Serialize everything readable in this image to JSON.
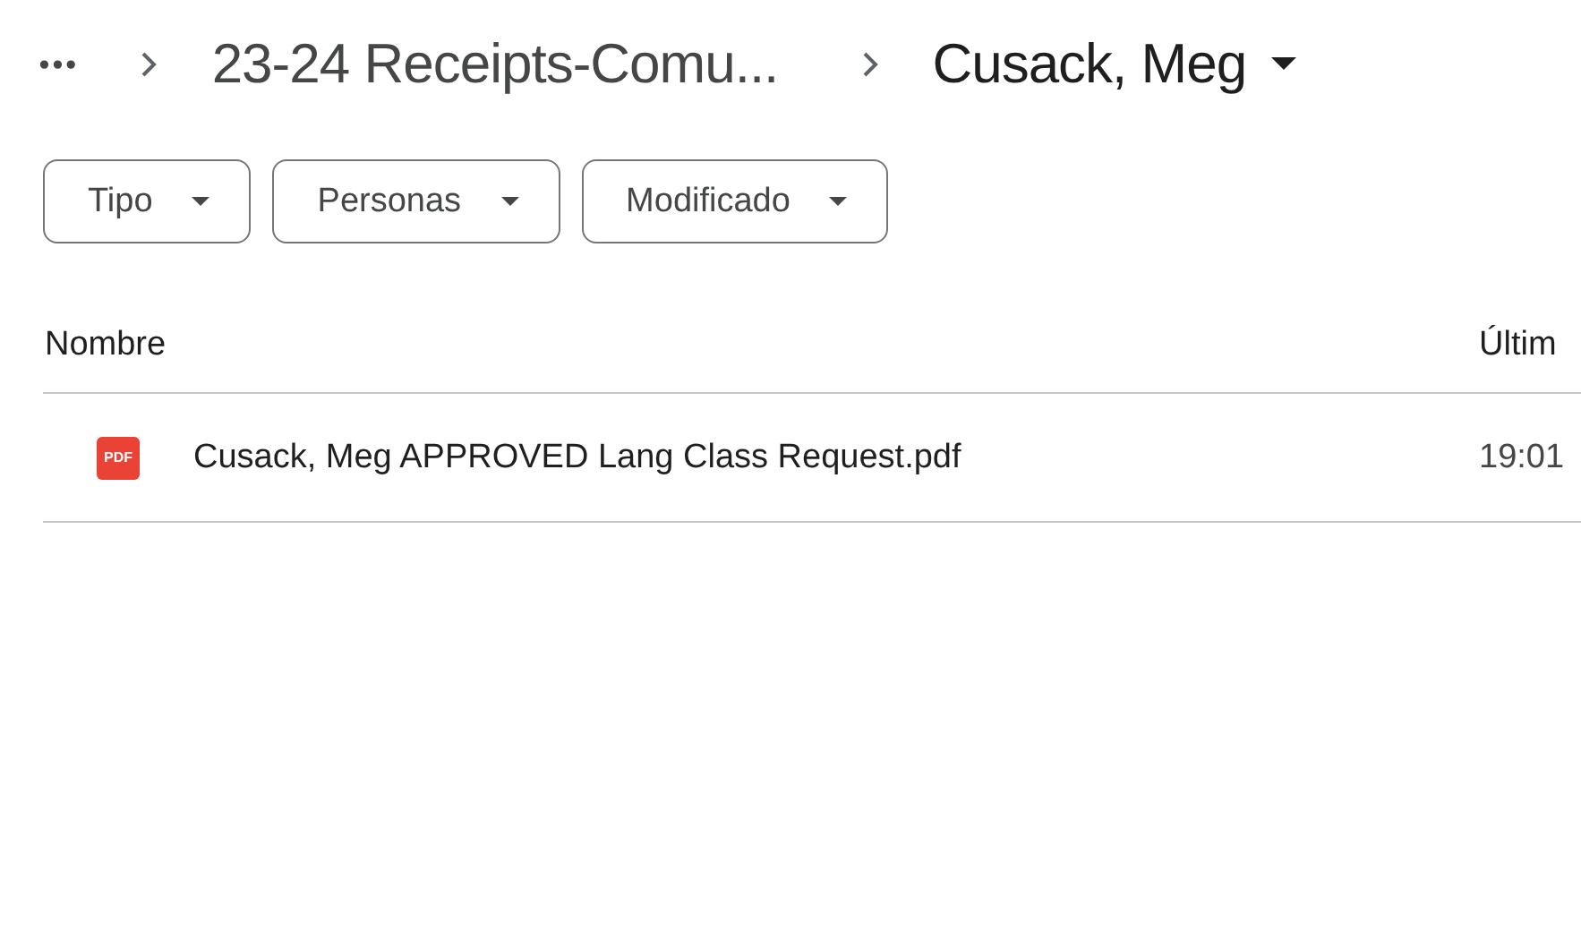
{
  "breadcrumb": {
    "more": "•••",
    "items": [
      {
        "label": "23-24 Receipts-Comu...",
        "current": false
      },
      {
        "label": "Cusack, Meg",
        "current": true
      }
    ]
  },
  "filters": [
    {
      "label": "Tipo"
    },
    {
      "label": "Personas"
    },
    {
      "label": "Modificado"
    }
  ],
  "table": {
    "columns": [
      "Nombre",
      "Últim"
    ],
    "rows": [
      {
        "icon": "PDF",
        "name": "Cusack, Meg APPROVED Lang Class Request.pdf",
        "modified": "19:01"
      }
    ]
  }
}
